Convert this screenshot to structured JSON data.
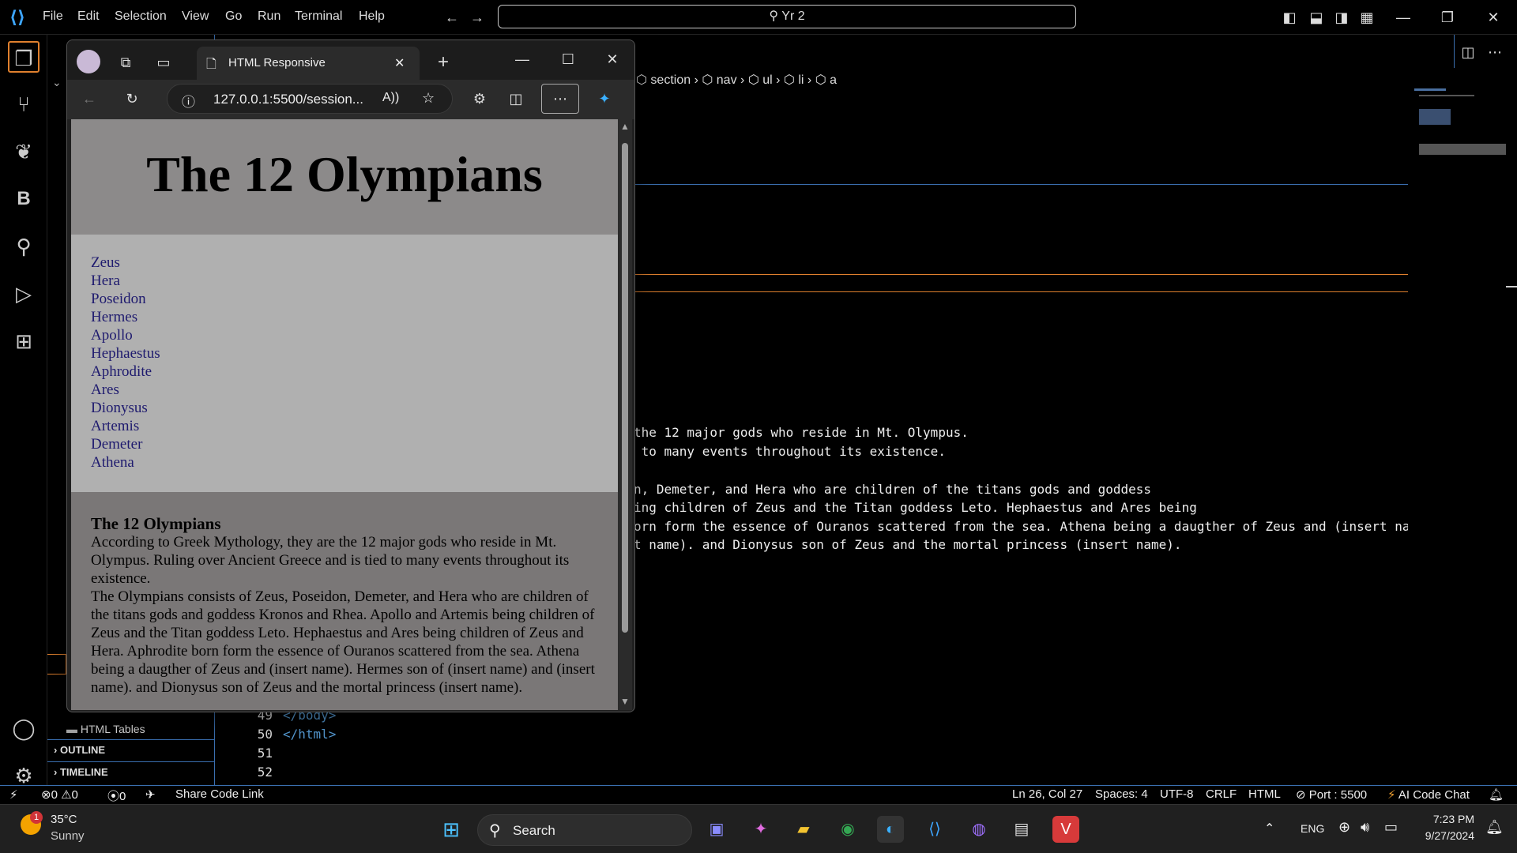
{
  "vscode": {
    "menu": [
      "File",
      "Edit",
      "Selection",
      "View",
      "Go",
      "Run",
      "Terminal",
      "Help"
    ],
    "search": "Yr 2",
    "breadcrumb": [
      "section",
      "nav",
      "ul",
      "li",
      "a"
    ],
    "code_lines": [
      "the 12 major gods who reside in Mt. Olympus.",
      " to many events throughout its existence.",
      "",
      "n, Demeter, and Hera who are children of the titans gods and goddess",
      "ing children of Zeus and the Titan goddess Leto. Hephaestus and Ares being",
      "orn form the essence of Ouranos scattered from the sea. Athena being a daugther of Zeus and (insert na",
      "t name). and Dionysus son of Zeus and the mortal princess (insert name)."
    ],
    "bottom_lines": [
      {
        "num": "49",
        "code": "</body>"
      },
      {
        "num": "50",
        "code": "</html>"
      },
      {
        "num": "51",
        "code": ""
      },
      {
        "num": "52",
        "code": ""
      }
    ],
    "sidebar": {
      "html_tables": "HTML Tables",
      "outline": "OUTLINE",
      "timeline": "TIMELINE"
    },
    "statusbar": {
      "errors": "0",
      "warnings": "0",
      "ports": "0",
      "share": "Share Code Link",
      "position": "Ln 26, Col 27",
      "spaces": "Spaces: 4",
      "encoding": "UTF-8",
      "eol": "CRLF",
      "language": "HTML",
      "port": "Port : 5500",
      "ai": "AI Code Chat"
    }
  },
  "browser": {
    "tab_title": "HTML Responsive",
    "address": "127.0.0.1:5500/session..."
  },
  "webpage": {
    "title": "The 12 Olympians",
    "nav": [
      "Zeus",
      "Hera",
      "Poseidon",
      "Hermes",
      "Apollo",
      "Hephaestus",
      "Aphrodite",
      "Ares",
      "Dionysus",
      "Artemis",
      "Demeter",
      "Athena"
    ],
    "section_title": "The 12 Olympians",
    "paragraph1": "According to Greek Mythology, they are the 12 major gods who reside in Mt. Olympus. Ruling over Ancient Greece and is tied to many events throughout its existence.",
    "paragraph2": "The Olympians consists of Zeus, Poseidon, Demeter, and Hera who are children of the titans gods and goddess Kronos and Rhea. Apollo and Artemis being children of Zeus and the Titan goddess Leto. Hephaestus and Ares being children of Zeus and Hera. Aphrodite born form the essence of Ouranos scattered from the sea. Athena being a daugther of Zeus and (insert name). Hermes son of (insert name) and (insert name). and Dionysus son of Zeus and the mortal princess (insert name)."
  },
  "taskbar": {
    "temperature": "35°C",
    "condition": "Sunny",
    "badge": "1",
    "search": "Search",
    "language": "ENG",
    "time": "7:23 PM",
    "date": "9/27/2024"
  },
  "colors": {
    "accent_blue": "#3a6fb0",
    "orange_line": "#e0802e",
    "nav_link": "#1e1a6e"
  }
}
